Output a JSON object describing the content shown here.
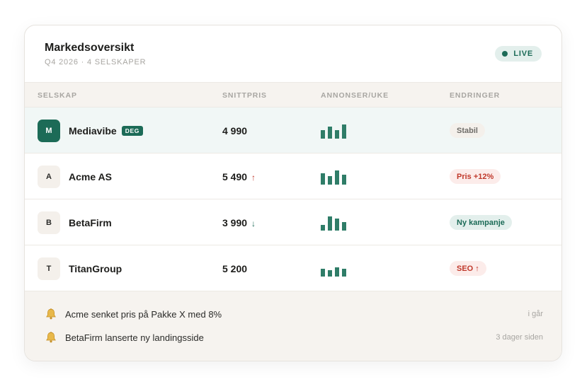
{
  "header": {
    "title": "Markedsoversikt",
    "subtitle": "Q4 2026 · 4 SELSKAPER",
    "live_label": "LIVE"
  },
  "columns": [
    "SELSKAP",
    "SNITTPRIS",
    "ANNONSER/UKE",
    "ENDRINGER"
  ],
  "rows": [
    {
      "initial": "M",
      "name": "Mediavibe",
      "badge": "DEG",
      "price": "4 990",
      "trend": "",
      "ads_per_week": [
        0.6,
        0.85,
        0.6,
        1.0
      ],
      "change": "Stabil",
      "change_tone": "neutral"
    },
    {
      "initial": "A",
      "name": "Acme AS",
      "badge": "",
      "price": "5 490",
      "trend": "↑",
      "ads_per_week": [
        0.8,
        0.6,
        1.0,
        0.7
      ],
      "change": "Pris +12%",
      "change_tone": "red"
    },
    {
      "initial": "B",
      "name": "BetaFirm",
      "badge": "",
      "price": "3 990",
      "trend": "↓",
      "ads_per_week": [
        0.4,
        1.0,
        0.85,
        0.6
      ],
      "change": "Ny kampanje",
      "change_tone": "green"
    },
    {
      "initial": "T",
      "name": "TitanGroup",
      "badge": "",
      "price": "5 200",
      "trend": "",
      "ads_per_week": [
        0.55,
        0.45,
        0.65,
        0.55
      ],
      "change": "SEO ↑",
      "change_tone": "red"
    }
  ],
  "notifications": [
    {
      "icon": "bell-icon",
      "text": "Acme senket pris på Pakke X med 8%",
      "time": "i går"
    },
    {
      "icon": "bell-icon",
      "text": "BetaFirm lanserte ny landingsside",
      "time": "3 dager siden"
    }
  ],
  "colors": {
    "accent": "#1c6b57",
    "bar": "#2f7d68",
    "up": "#c0392b",
    "self_row": "#f1f7f6"
  }
}
